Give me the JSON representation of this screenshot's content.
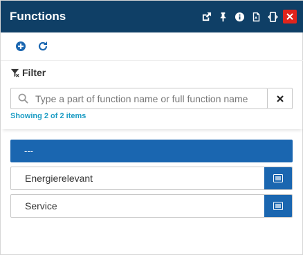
{
  "window": {
    "title": "Functions"
  },
  "titlebar_icons": [
    "external-link-icon",
    "pin-icon",
    "info-icon",
    "pdf-icon",
    "resize-icon",
    "close-icon"
  ],
  "toolbar": {
    "icons": [
      "add-icon",
      "refresh-icon"
    ]
  },
  "filter": {
    "label": "Filter",
    "placeholder": "Type a part of function name or full function name",
    "value": "",
    "status": "Showing 2 of 2 items"
  },
  "list": {
    "selected": {
      "label": "---"
    },
    "items": [
      {
        "label": "Energierelevant"
      },
      {
        "label": "Service"
      }
    ]
  },
  "colors": {
    "titlebar": "#0f3f66",
    "accent": "#1a66b0",
    "close": "#e0241c",
    "status_text": "#1b9cc4"
  }
}
